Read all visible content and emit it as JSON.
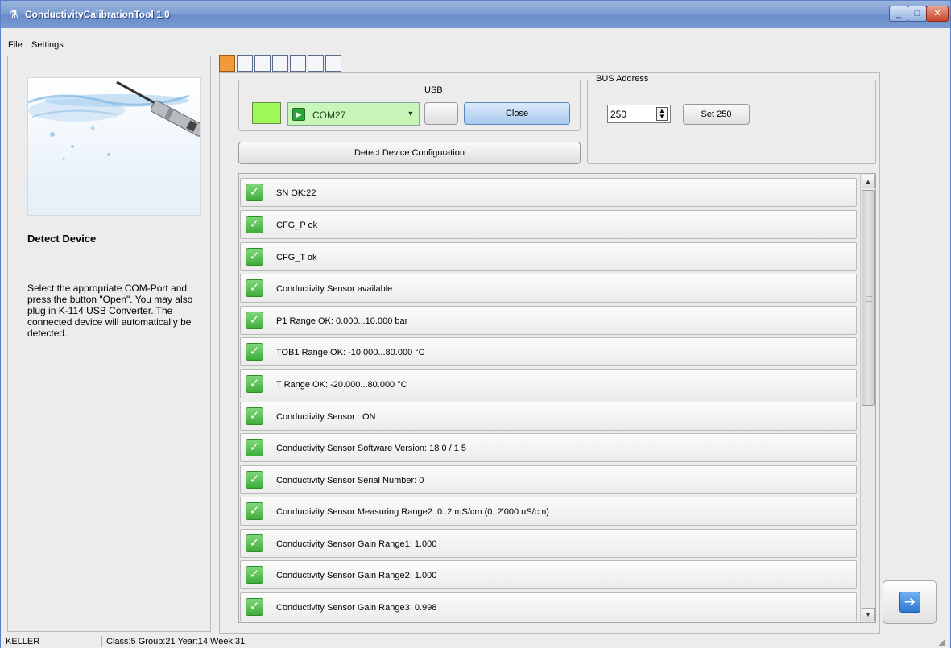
{
  "window": {
    "title": "ConductivityCalibrationTool 1.0"
  },
  "menu": {
    "items": [
      "File",
      "Settings"
    ]
  },
  "left": {
    "title": "Detect Device",
    "description": "Select the appropriate COM-Port and press the button \"Open\". You may also plug in K-114 USB Converter. The connected device will automatically be detected."
  },
  "steps": {
    "count": 7,
    "active_index": 0
  },
  "usb": {
    "label": "USB",
    "port": "COM27",
    "close_label": "Close",
    "detect_label": "Detect Device Configuration",
    "lamp_color": "#9ef85a"
  },
  "bus": {
    "label": "BUS Address",
    "value": "250",
    "set_label": "Set 250"
  },
  "results": [
    "SN OK:22",
    "CFG_P ok",
    "CFG_T ok",
    "Conductivity Sensor available",
    "P1 Range OK: 0.000...10.000 bar",
    "TOB1 Range OK: -10.000...80.000 °C",
    "T Range OK: -20.000...80.000 °C",
    "Conductivity Sensor : ON",
    "Conductivity Sensor Software Version: 18 0 / 1 5",
    "Conductivity Sensor Serial Number: 0",
    "Conductivity Sensor Measuring Range2: 0..2 mS/cm (0..2'000 uS/cm)",
    "Conductivity Sensor Gain Range1: 1.000",
    "Conductivity Sensor Gain Range2: 1.000",
    "Conductivity Sensor Gain Range3: 0.998"
  ],
  "status": {
    "vendor": "KELLER",
    "info": "Class:5 Group:21 Year:14 Week:31"
  },
  "colors": {
    "accent_step": "#f29a3a",
    "check_green": "#3fae3a"
  },
  "icons": {
    "app": "flask-icon",
    "next": "arrow-right-icon",
    "check": "checkmark-icon"
  }
}
